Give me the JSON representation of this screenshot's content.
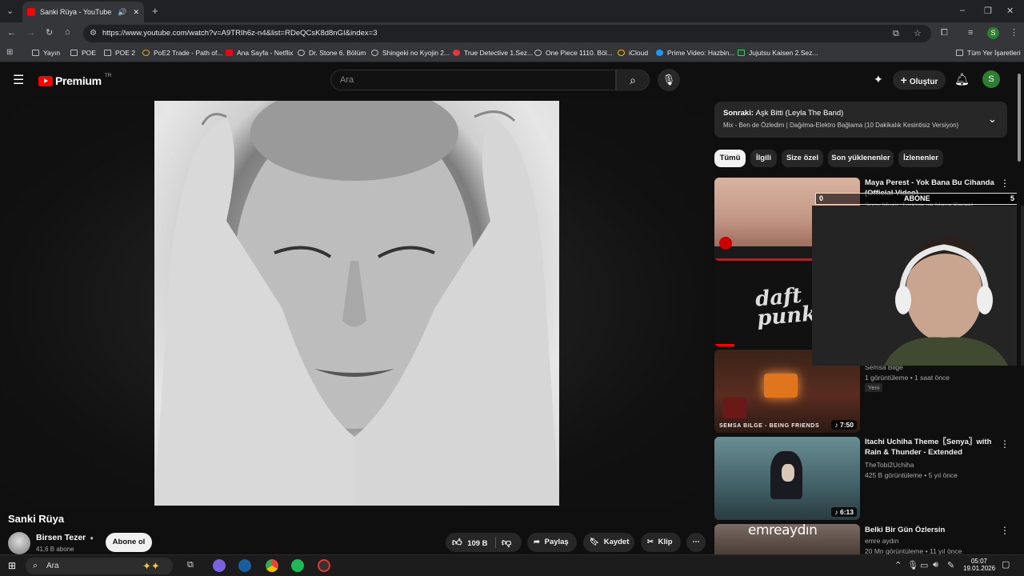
{
  "browser": {
    "tab_title": "Sanki Rüya - YouTube",
    "url": "https://www.youtube.com/watch?v=A9TRIh6z-n4&list=RDeQCsK8d8nGI&index=3",
    "bookmarks": [
      "Yayın",
      "POE",
      "POE 2",
      "PoE2 Trade - Path of...",
      "Ana Sayfa - Netflix",
      "Dr. Stone 6. Bölüm",
      "Shingeki no Kyojin 2...",
      "True Detective 1.Sez...",
      "One Piece 1110. Böl...",
      "iCloud",
      "Prime Video: Hazbin...",
      "Jujutsu Kaisen 2.Sez..."
    ],
    "all_bookmarks": "Tüm Yer İşaretleri",
    "profile_initial": "S"
  },
  "youtube": {
    "logo_text": "Premium",
    "region": "TR",
    "search_placeholder": "Ara",
    "create_label": "Oluştur",
    "avatar_initial": "S"
  },
  "video": {
    "title": "Sanki Rüya",
    "channel": "Birsen Tezer",
    "subscribers": "41,6 B abone",
    "subscribe_label": "Abone ol",
    "likes": "109 B",
    "share_label": "Paylaş",
    "save_label": "Kaydet",
    "clip_label": "Klip"
  },
  "up_next": {
    "prefix": "Sonraki:",
    "title": "Aşk Bitti (Leyla The Band)",
    "mix": "Mix - Ben de Özledim | Dağılma-Elektro Bağlama (10 Dakikalık Kesintisiz Versiyon)"
  },
  "filters": [
    "Tümü",
    "İlgili",
    "Size özel",
    "Son yüklenenler",
    "İzlenenler"
  ],
  "recommendations": [
    {
      "title": "Maya Perest  - Yok Bana Bu Cihanda (Official Video)",
      "channel": "Sony Music Türkiye ve Maya Perest",
      "meta": "",
      "badge": "",
      "duration": ""
    },
    {
      "title": "",
      "channel": "",
      "meta": "",
      "badge": "",
      "duration": ""
    },
    {
      "title": "",
      "channel": "Semsa Bilge",
      "meta": "1 görüntüleme • 1 saat önce",
      "badge": "Yeni",
      "duration": "7:50"
    },
    {
      "title": "Itachi Uchiha Theme〖Senya〗with Rain & Thunder - Extended",
      "channel": "TheTobi2Uchiha",
      "meta": "425 B görüntüleme • 5 yıl önce",
      "badge": "",
      "duration": "6:13"
    },
    {
      "title": "Belki Bir Gün Özlersin",
      "channel": "emre aydın",
      "meta": "20 Mn görüntüleme • 11 yıl önce",
      "badge": "",
      "duration": ""
    }
  ],
  "thumb_text": {
    "daft": "daft punk",
    "semsa": "SEMSA BILGE - BEING FRIENDS",
    "emre": "emreaydın"
  },
  "overlay": {
    "sub_left": "0",
    "sub_label": "ABONE",
    "sub_right": "5"
  },
  "taskbar": {
    "search": "Ara",
    "time": "05:07",
    "date": "19.01.2026"
  }
}
